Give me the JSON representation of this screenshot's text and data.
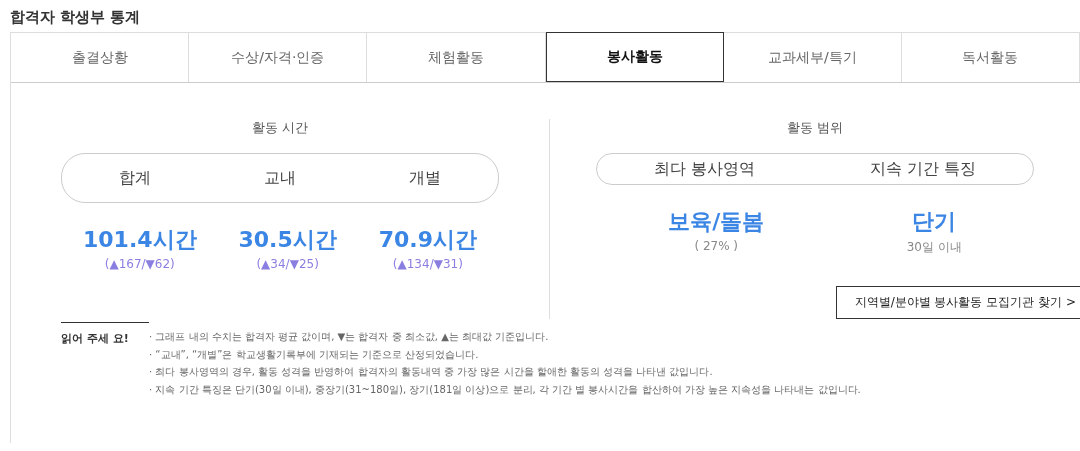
{
  "page_title": "합격자 학생부 통계",
  "tabs": [
    {
      "label": "출결상황",
      "selected": false
    },
    {
      "label": "수상/자격·인증",
      "selected": false
    },
    {
      "label": "체험활동",
      "selected": false
    },
    {
      "label": "봉사활동",
      "selected": true
    },
    {
      "label": "교과세부/특기",
      "selected": false
    },
    {
      "label": "독서활동",
      "selected": false
    }
  ],
  "activity_hours": {
    "title": "활동 시간",
    "headers": [
      "합계",
      "교내",
      "개별"
    ],
    "values": [
      {
        "value": "101.4시간",
        "range": "(▲167/▼62)"
      },
      {
        "value": "30.5시간",
        "range": "(▲34/▼25)"
      },
      {
        "value": "70.9시간",
        "range": "(▲134/▼31)"
      }
    ]
  },
  "activity_scope": {
    "title": "활동 범위",
    "headers": [
      "최다 봉사영역",
      "지속 기간 특징"
    ],
    "values": [
      {
        "value": "보육/돌봄",
        "detail": "( 27% )"
      },
      {
        "value": "단기",
        "detail": "30일 이내"
      }
    ],
    "link": "지역별/분야별 봉사활동 모집기관 찾기 >"
  },
  "notes": {
    "title": "읽어 주세 요!",
    "items": [
      "· 그래프 내의 수치는 합격자 평균 값이며, ▼는 합격자 중 최소값, ▲는 최대값 기준입니다.",
      "· “교내”, “개별”은 학교생활기록부에 기재되는 기준으로 산정되었습니다.",
      "· 최다 봉사영역의 경우, 활동 성격을 반영하여 합격자의 활동내역 중 가장 많은 시간을 할애한 활동의 성격을 나타낸 값입니다.",
      "· 지속 기간 특징은 단기(30일 이내), 중장기(31~180일), 장기(181일 이상)으로 분리, 각 기간 별 봉사시간을 합산하여 가장 높은 지속성을 나타내는 값입니다."
    ]
  }
}
